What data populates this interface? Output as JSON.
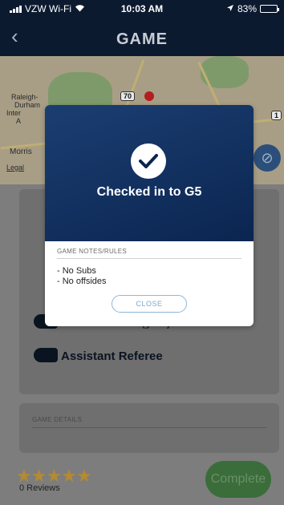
{
  "status_bar": {
    "carrier": "VZW Wi-Fi",
    "time": "10:03 AM",
    "battery_percent": "83%",
    "battery_level": 0.83
  },
  "nav": {
    "back_icon": "chevron-left-icon",
    "title": "GAME"
  },
  "map": {
    "labels": {
      "raleigh": "Raleigh-",
      "durham": "Durham",
      "inter": "Inter",
      "a": "A",
      "morris": "Morris",
      "legal": "Legal"
    },
    "shields": [
      "70",
      "1"
    ]
  },
  "modal": {
    "title": "Checked in to G5",
    "notes_header": "GAME NOTES/RULES",
    "notes": [
      "- No Subs",
      "- No offsides"
    ],
    "close_label": "CLOSE",
    "header_color": "#1b3e72"
  },
  "background": {
    "head_referee_label": "Head Referee (you)",
    "assistant_referee_label": "Assistant Referee",
    "game_details_header": "GAME DETAILS"
  },
  "footer": {
    "reviews_label": "0 Reviews",
    "rating_stars": 5,
    "complete_label": "Complete"
  }
}
